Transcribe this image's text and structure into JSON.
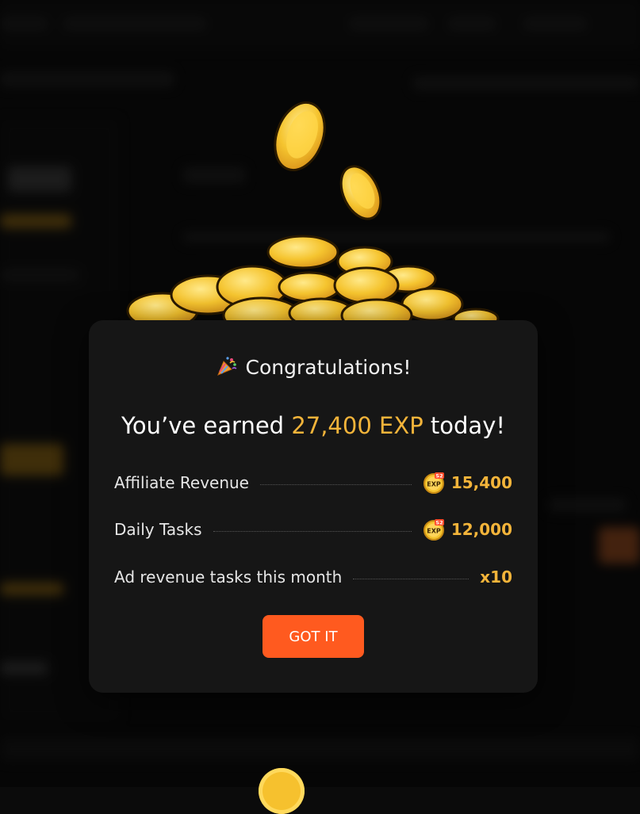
{
  "modal": {
    "title": "Congratulations!",
    "headline_prefix": "You’ve earned ",
    "headline_amount": "27,400 EXP",
    "headline_suffix": " today!",
    "rows": [
      {
        "label": "Affiliate Revenue",
        "value": "15,400",
        "icon": "exp-s2-coin-icon"
      },
      {
        "label": "Daily Tasks",
        "value": "12,000",
        "icon": "exp-s2-coin-icon"
      },
      {
        "label": "Ad revenue tasks this month",
        "value": "x10"
      }
    ],
    "button_label": "GOT IT",
    "badge_text": "EXP",
    "badge_season": "S2"
  },
  "colors": {
    "accent": "#f3b43a",
    "button": "#ff5a1f",
    "modal_bg": "#161616"
  },
  "icons": {
    "title_icon": "party-popper-icon",
    "background_art": "gold-coins-pile-icon"
  }
}
